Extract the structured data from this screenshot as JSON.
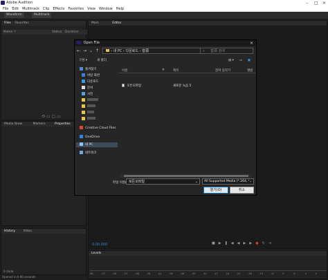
{
  "app": {
    "title": "Adobe Audition"
  },
  "menu": [
    "File",
    "Edit",
    "Multitrack",
    "Clip",
    "Effects",
    "Favorites",
    "View",
    "Window",
    "Help"
  ],
  "toolbar": {
    "waveform": "Waveform",
    "multitrack": "Multitrack"
  },
  "files_panel": {
    "tab_files": "Files",
    "tab_favorites": "Favorites",
    "col_name": "Name ↑",
    "col_status": "Status",
    "col_duration": "Duration"
  },
  "editor_panel": {
    "tab_main": "Main",
    "tab_editor": "Editor",
    "time": "0:00.000"
  },
  "bottom_panels": {
    "media_browser": "Media Brow",
    "markers": "Markers",
    "properties": "Properties",
    "history": "History",
    "video": "Video",
    "undo_status": "0 Undo",
    "open_status": "Opened in 6.60 seconds"
  },
  "levels": {
    "label": "Levels",
    "ticks": [
      "dB",
      "-57",
      "-54",
      "-51",
      "-48",
      "-45",
      "-42",
      "-39",
      "-36",
      "-33",
      "-30",
      "-27",
      "-24",
      "-21",
      "-18",
      "-15",
      "-12",
      "-9",
      "-6",
      "-3",
      "0"
    ]
  },
  "dialog": {
    "title": "Open File",
    "breadcrumb": "› 내 PC › 다운로드 › 音源",
    "search_placeholder": "音源 검색",
    "organize": "구성 ▾",
    "new_folder": "새 폴더",
    "columns": [
      "이름",
      "#",
      "제목",
      "참여 음악가",
      "앨범"
    ],
    "rows": [
      {
        "name": "모든오파일",
        "title": "새로운 녹음 5"
      }
    ],
    "sidebar": [
      {
        "label": "즐겨찾기",
        "icon": "star-icon"
      },
      {
        "label": "바탕 화면",
        "icon": "desktop-icon"
      },
      {
        "label": "다운로드",
        "icon": "download-icon"
      },
      {
        "label": "문서",
        "icon": "document-icon"
      },
      {
        "label": "사진",
        "icon": "picture-icon"
      },
      {
        "label": "",
        "icon": "folder-icon"
      },
      {
        "label": "",
        "icon": "folder-icon"
      },
      {
        "label": "",
        "icon": "folder-icon"
      },
      {
        "label": "",
        "icon": "folder-icon"
      },
      {
        "label": "Creative Cloud Files",
        "icon": "cloud-icon"
      },
      {
        "label": "OneDrive",
        "icon": "onedrive-icon"
      },
      {
        "label": "내 PC",
        "icon": "pc-icon"
      },
      {
        "label": "네트워크",
        "icon": "network-icon"
      }
    ],
    "filename_label": "파일 이름(N):",
    "filename_value": "모든오파일",
    "filetype_value": "All Supported Media (*.264, *.",
    "open_button": "열기(O)",
    "cancel_button": "취소"
  }
}
